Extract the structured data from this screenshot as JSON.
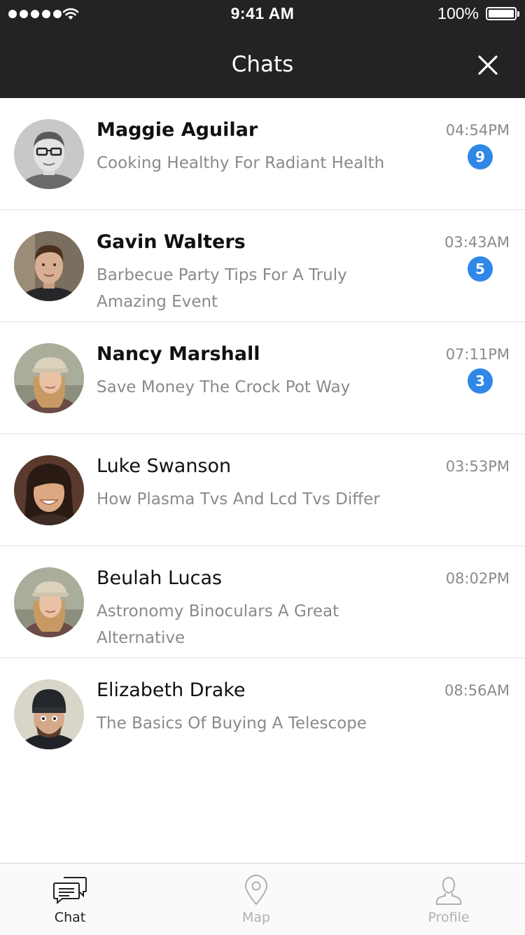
{
  "status_bar": {
    "time": "9:41 AM",
    "battery": "100%"
  },
  "header": {
    "title": "Chats"
  },
  "chats": [
    {
      "name": "Maggie Aguilar",
      "preview": "Cooking Healthy For Radiant Health",
      "time": "04:54PM",
      "unread": "9"
    },
    {
      "name": "Gavin Walters",
      "preview": "Barbecue Party Tips For A Truly Amazing Event",
      "time": "03:43AM",
      "unread": "5"
    },
    {
      "name": "Nancy Marshall",
      "preview": "Save Money The Crock Pot Way",
      "time": "07:11PM",
      "unread": "3"
    },
    {
      "name": "Luke Swanson",
      "preview": "How Plasma Tvs And Lcd Tvs Differ",
      "time": "03:53PM"
    },
    {
      "name": "Beulah Lucas",
      "preview": "Astronomy Binoculars A Great Alternative",
      "time": "08:02PM"
    },
    {
      "name": "Elizabeth Drake",
      "preview": "The Basics Of Buying A Telescope",
      "time": "08:56AM"
    }
  ],
  "tabbar": {
    "tabs": [
      {
        "label": "Chat",
        "icon": "chat-bubbles-icon",
        "active": true
      },
      {
        "label": "Map",
        "icon": "map-pin-icon",
        "active": false
      },
      {
        "label": "Profile",
        "icon": "person-icon",
        "active": false
      }
    ]
  },
  "colors": {
    "header_bg": "#232323",
    "badge": "#2f87e6",
    "muted_text": "#8a8a8a"
  }
}
